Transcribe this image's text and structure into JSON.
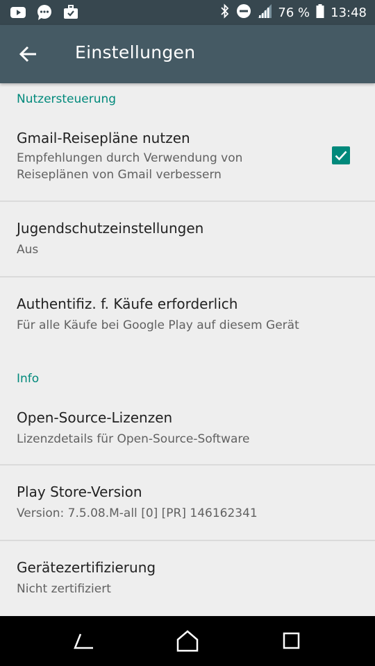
{
  "status_bar": {
    "battery_percent": "76 %",
    "time": "13:48",
    "left_icons": [
      "youtube-icon",
      "chat-bubble-icon",
      "briefcase-check-icon"
    ],
    "right_icons": [
      "bluetooth-icon",
      "do-not-disturb-icon",
      "signal-icon",
      "battery-icon"
    ]
  },
  "app_bar": {
    "title": "Einstellungen"
  },
  "sections": {
    "user_controls": {
      "header": "Nutzersteuerung",
      "gmail_travel": {
        "title": "Gmail-Reisepläne nutzen",
        "summary_line1": "Empfehlungen durch Verwendung von",
        "summary_line2": "Reiseplänen von Gmail verbessern",
        "checked": true
      },
      "parental": {
        "title": "Jugendschutzeinstellungen",
        "summary": "Aus"
      },
      "purchase_auth": {
        "title": "Authentifiz. f. Käufe erforderlich",
        "summary": "Für alle Käufe bei Google Play auf diesem Gerät"
      }
    },
    "info": {
      "header": "Info",
      "licenses": {
        "title": "Open-Source-Lizenzen",
        "summary": "Lizenzdetails für Open-Source-Software"
      },
      "version": {
        "title": "Play Store-Version",
        "summary": "Version: 7.5.08.M-all [0] [PR] 146162341"
      },
      "certification": {
        "title": "Gerätezertifizierung",
        "summary": "Nicht zertifiziert"
      }
    }
  },
  "colors": {
    "status_bar": "#37474f",
    "app_bar": "#455a64",
    "accent": "#00897b",
    "background": "#eeeeee"
  },
  "nav_bar": {
    "icons": [
      "back-icon",
      "home-icon",
      "recents-icon"
    ]
  }
}
